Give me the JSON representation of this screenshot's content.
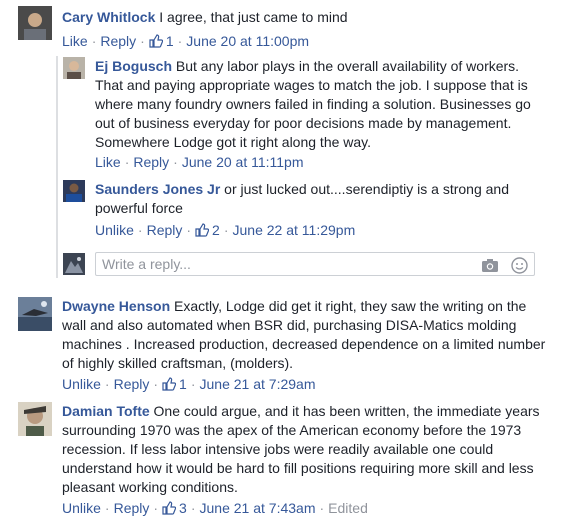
{
  "comments": [
    {
      "author": "Cary Whitlock",
      "text": "I agree, that just came to mind",
      "action1": "Like",
      "reply": "Reply",
      "likes": "1",
      "time": "June 20 at 11:00pm"
    },
    {
      "author": "Ej Bogusch",
      "line1": "But any labor plays in the overall availability of workers.",
      "line2": "That and paying appropriate wages to match the job. I suppose that is",
      "line3": "where many foundry owners failed in finding a solution. Businesses go",
      "line4": "out of business everyday for poor decisions made by management.",
      "line5": "Somewhere Lodge got it right along the way.",
      "action1": "Like",
      "reply": "Reply",
      "time": "June 20 at 11:11pm"
    },
    {
      "author": "Saunders Jones Jr",
      "line1": "or just lucked out....serendiptiy is a strong and",
      "line2": "powerful force",
      "action1": "Unlike",
      "reply": "Reply",
      "likes": "2",
      "time": "June 22 at 11:29pm"
    },
    {
      "author": "Dwayne Henson",
      "line1": "Exactly, Lodge did get it right, they saw the writing on the",
      "line2": "wall and also automated when BSR did, purchasing DISA-Matics molding",
      "line3": "machines . Increased production, decreased dependence on a limited number",
      "line4": "of highly skilled craftsman, (molders).",
      "action1": "Unlike",
      "reply": "Reply",
      "likes": "1",
      "time": "June 21 at 7:29am"
    },
    {
      "author": "Damian Tofte",
      "line1": "One could argue, and it has been written, the immediate years",
      "line2": "surrounding 1970 was the apex of the American economy before the 1973",
      "line3": "recession. If less labor intensive jobs were readily available one could",
      "line4": "understand how it would be hard to fill positions requiring more skill and less",
      "line5": "pleasant working conditions.",
      "action1": "Unlike",
      "reply": "Reply",
      "likes": "3",
      "time": "June 21 at 7:43am",
      "edited": "Edited"
    }
  ],
  "reply_box": {
    "placeholder": "Write a reply...",
    "camera_icon": "camera-icon",
    "emoji_icon": "emoji-icon"
  },
  "colors": {
    "link": "#365899",
    "meta": "#90949c",
    "text": "#1d2129"
  }
}
